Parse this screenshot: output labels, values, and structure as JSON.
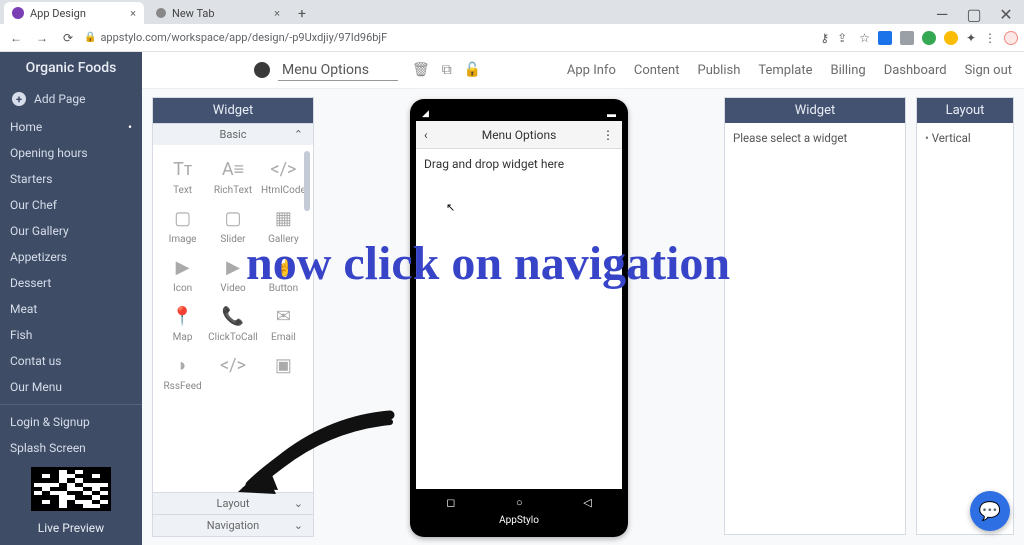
{
  "browser": {
    "tabs": [
      {
        "title": "App Design",
        "favicon": "#7b3fb5",
        "active": true
      },
      {
        "title": "New Tab",
        "favicon": "#888",
        "active": false
      }
    ],
    "url": "appstylo.com/workspace/app/design/-p9Uxdjiy/97Id96bjF"
  },
  "sidebar": {
    "app_name": "Organic Foods",
    "add_page": "Add Page",
    "pages": [
      "Home",
      "Opening hours",
      "Starters",
      "Our Chef",
      "Our Gallery",
      "Appetizers",
      "Dessert",
      "Meat",
      "Fish",
      "Contat us",
      "Our Menu"
    ],
    "special": [
      "Login & Signup",
      "Splash Screen"
    ],
    "live_preview": "Live Preview"
  },
  "topbar": {
    "page_title_value": "Menu Options",
    "nav": [
      "App Info",
      "Content",
      "Publish",
      "Template",
      "Billing",
      "Dashboard",
      "Sign out"
    ]
  },
  "widget_panel": {
    "title": "Widget",
    "section_open": "Basic",
    "section_collapsed_1": "Layout",
    "section_collapsed_2": "Navigation",
    "widgets": [
      {
        "name": "Text",
        "icon": "Tᴛ"
      },
      {
        "name": "RichText",
        "icon": "A≡"
      },
      {
        "name": "HtmlCode",
        "icon": "</>"
      },
      {
        "name": "Image",
        "icon": "▢"
      },
      {
        "name": "Slider",
        "icon": "▢"
      },
      {
        "name": "Gallery",
        "icon": "▦"
      },
      {
        "name": "Icon",
        "icon": "▶"
      },
      {
        "name": "Video",
        "icon": "▶"
      },
      {
        "name": "Button",
        "icon": "☝"
      },
      {
        "name": "Map",
        "icon": "📍"
      },
      {
        "name": "ClickToCall",
        "icon": "📞"
      },
      {
        "name": "Email",
        "icon": "✉"
      },
      {
        "name": "RssFeed",
        "icon": "◗"
      },
      {
        "name": "",
        "icon": "</>"
      },
      {
        "name": "",
        "icon": "▣"
      }
    ]
  },
  "phone": {
    "header_title": "Menu Options",
    "dropzone_hint": "Drag and drop widget here",
    "brand": "AppStylo"
  },
  "right": {
    "widget_title": "Widget",
    "widget_placeholder": "Please select a widget",
    "layout_title": "Layout",
    "layout_option": "Vertical"
  },
  "annotation": "now click on navigation"
}
